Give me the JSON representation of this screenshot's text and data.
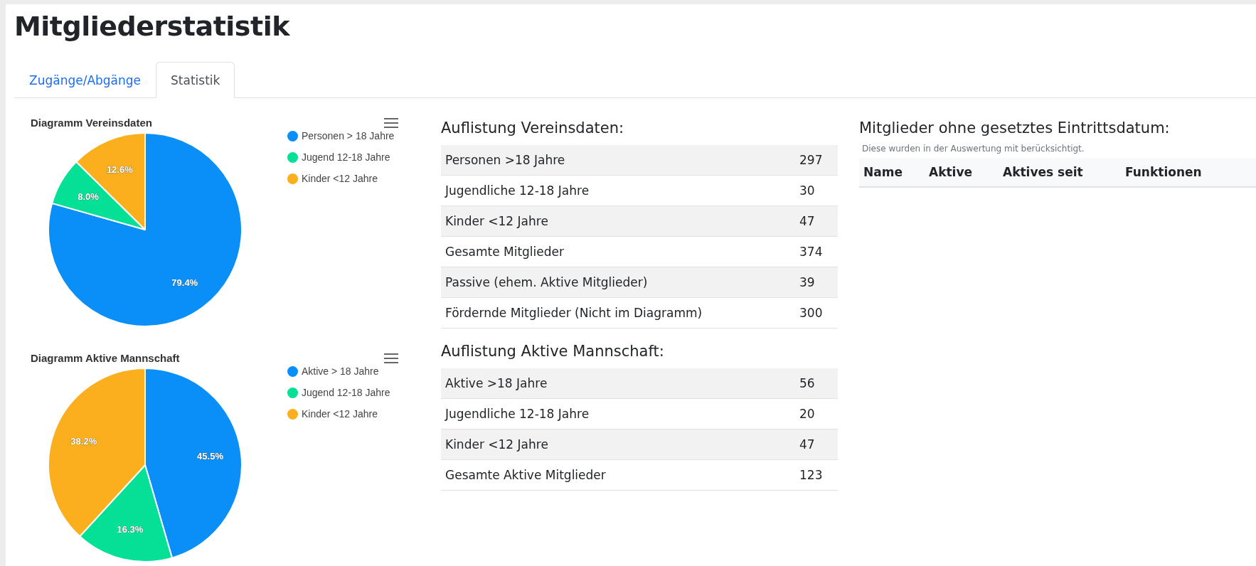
{
  "page_title": "Mitgliederstatistik",
  "tabs": [
    {
      "label": "Zugänge/Abgänge",
      "selected": false
    },
    {
      "label": "Statistik",
      "selected": true
    }
  ],
  "charts": [
    {
      "chart_data": {
        "type": "pie",
        "legend": "right",
        "title": "Diagramm Vereinsdaten",
        "categories": [
          "Personen > 18 Jahre",
          "Jugend 12-18 Jahre",
          "Kinder <12 Jahre"
        ],
        "colors": [
          "#0a8ff8",
          "#04e095",
          "#fcaf1c"
        ],
        "values": [
          79.4,
          8.0,
          12.6
        ],
        "value_labels": [
          "79.4%",
          "8.0%",
          "12.6%"
        ]
      }
    },
    {
      "chart_data": {
        "type": "pie",
        "legend": "right",
        "title": "Diagramm Aktive Mannschaft",
        "categories": [
          "Aktive > 18 Jahre",
          "Jugend 12-18 Jahre",
          "Kinder <12 Jahre"
        ],
        "colors": [
          "#0a8ff8",
          "#04e095",
          "#fcaf1c"
        ],
        "values": [
          45.5,
          16.3,
          38.2
        ],
        "value_labels": [
          "45.5%",
          "16.3%",
          "38.2%"
        ]
      }
    }
  ],
  "listings": [
    {
      "heading": "Auflistung Vereinsdaten:",
      "rows": [
        {
          "label": "Personen >18 Jahre",
          "value": "297"
        },
        {
          "label": "Jugendliche 12-18 Jahre",
          "value": "30"
        },
        {
          "label": "Kinder <12 Jahre",
          "value": "47"
        },
        {
          "label": "Gesamte Mitglieder",
          "value": "374"
        },
        {
          "label": "Passive (ehem. Aktive Mitglieder)",
          "value": "39"
        },
        {
          "label": "Fördernde Mitglieder (Nicht im Diagramm)",
          "value": "300"
        }
      ]
    },
    {
      "heading": "Auflistung Aktive Mannschaft:",
      "rows": [
        {
          "label": "Aktive >18 Jahre",
          "value": "56"
        },
        {
          "label": "Jugendliche 12-18 Jahre",
          "value": "20"
        },
        {
          "label": "Kinder <12 Jahre",
          "value": "47"
        },
        {
          "label": "Gesamte Aktive Mitglieder",
          "value": "123"
        }
      ]
    }
  ],
  "no_entry_date": {
    "heading": "Mitglieder ohne gesetztes Eintrittsdatum:",
    "note": "Diese wurden in der Auswertung mit berücksichtigt.",
    "columns": [
      "Name",
      "Aktive",
      "Aktives seit",
      "Funktionen"
    ]
  }
}
